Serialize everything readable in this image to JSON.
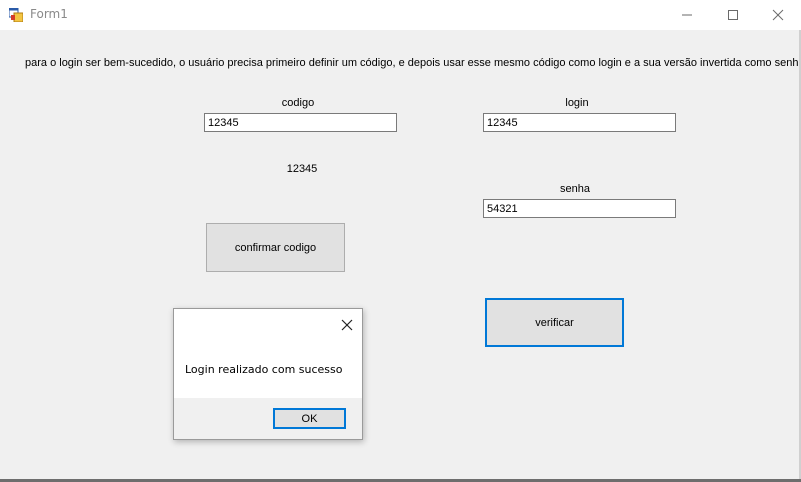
{
  "window": {
    "title": "Form1"
  },
  "form": {
    "instructions": "para o login ser bem-sucedido, o usuário precisa primeiro definir um código, e depois usar esse mesmo código como login e a sua versão invertida como senha.",
    "codigo_label": "codigo",
    "codigo_value": "12345",
    "codigo_display": "12345",
    "confirm_button": "confirmar codigo",
    "login_label": "login",
    "login_value": "12345",
    "senha_label": "senha",
    "senha_value": "54321",
    "verify_button": "verificar"
  },
  "dialog": {
    "message": "Login realizado com sucesso",
    "ok_label": "OK"
  },
  "icons": {
    "app": "windows-form-icon",
    "minimize": "minimize-icon",
    "maximize": "maximize-icon",
    "close": "close-icon"
  },
  "colors": {
    "focus_border": "#0078d7",
    "form_background": "#f0f0f0"
  }
}
